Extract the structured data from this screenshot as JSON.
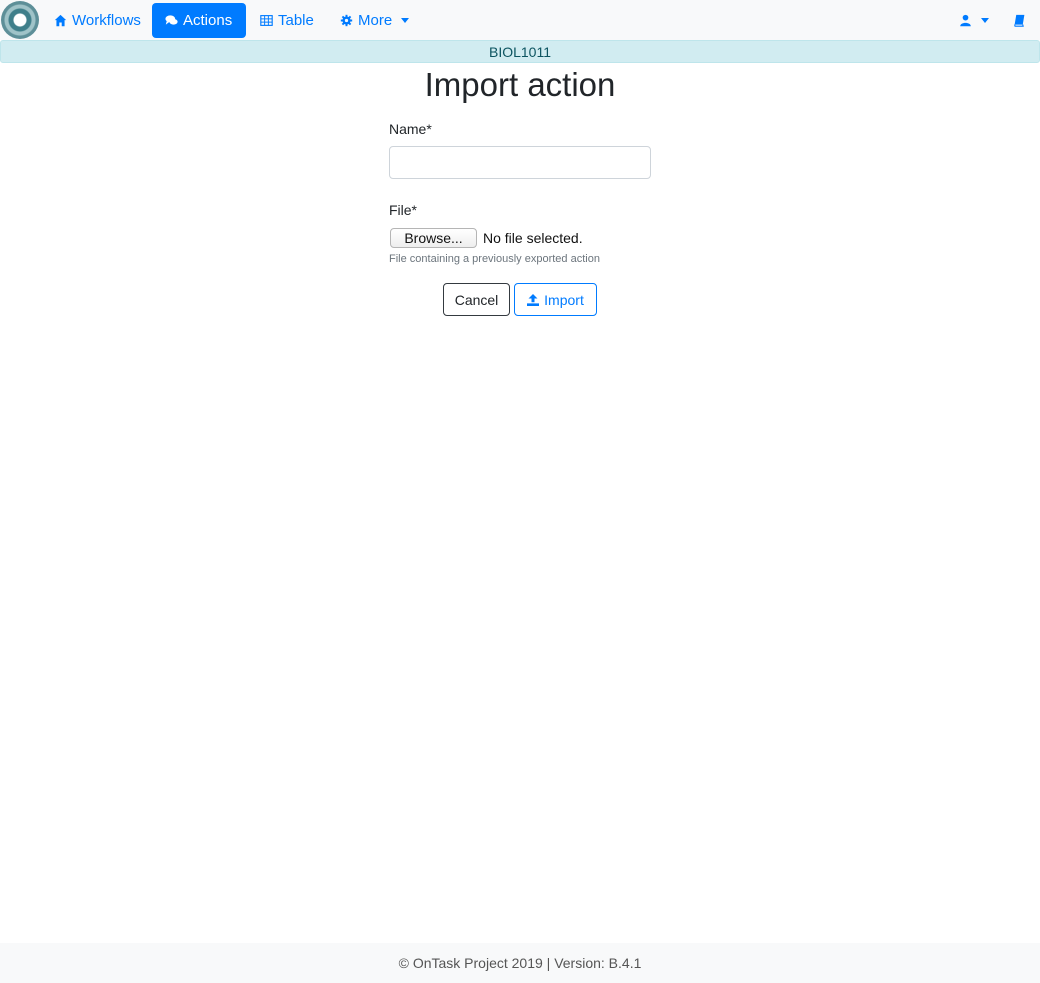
{
  "nav": {
    "workflows": "Workflows",
    "actions": "Actions",
    "table": "Table",
    "more": "More"
  },
  "workflow_banner": "BIOL1011",
  "page": {
    "title": "Import action"
  },
  "form": {
    "name_label": "Name*",
    "name_value": "",
    "file_label": "File*",
    "browse_label": "Browse...",
    "file_status": "No file selected.",
    "file_help": "File containing a previously exported action",
    "cancel_label": "Cancel",
    "import_label": "Import"
  },
  "footer": "© OnTask Project 2019 | Version: B.4.1",
  "colors": {
    "primary": "#007bff",
    "banner_bg": "#d1ecf1",
    "navbar_bg": "#f8f9fa"
  },
  "icons": {
    "workflows": "home-icon",
    "actions": "comments-icon",
    "table": "table-icon",
    "more": "cog-icon",
    "user": "user-icon",
    "docs": "book-icon",
    "import": "upload-icon"
  }
}
